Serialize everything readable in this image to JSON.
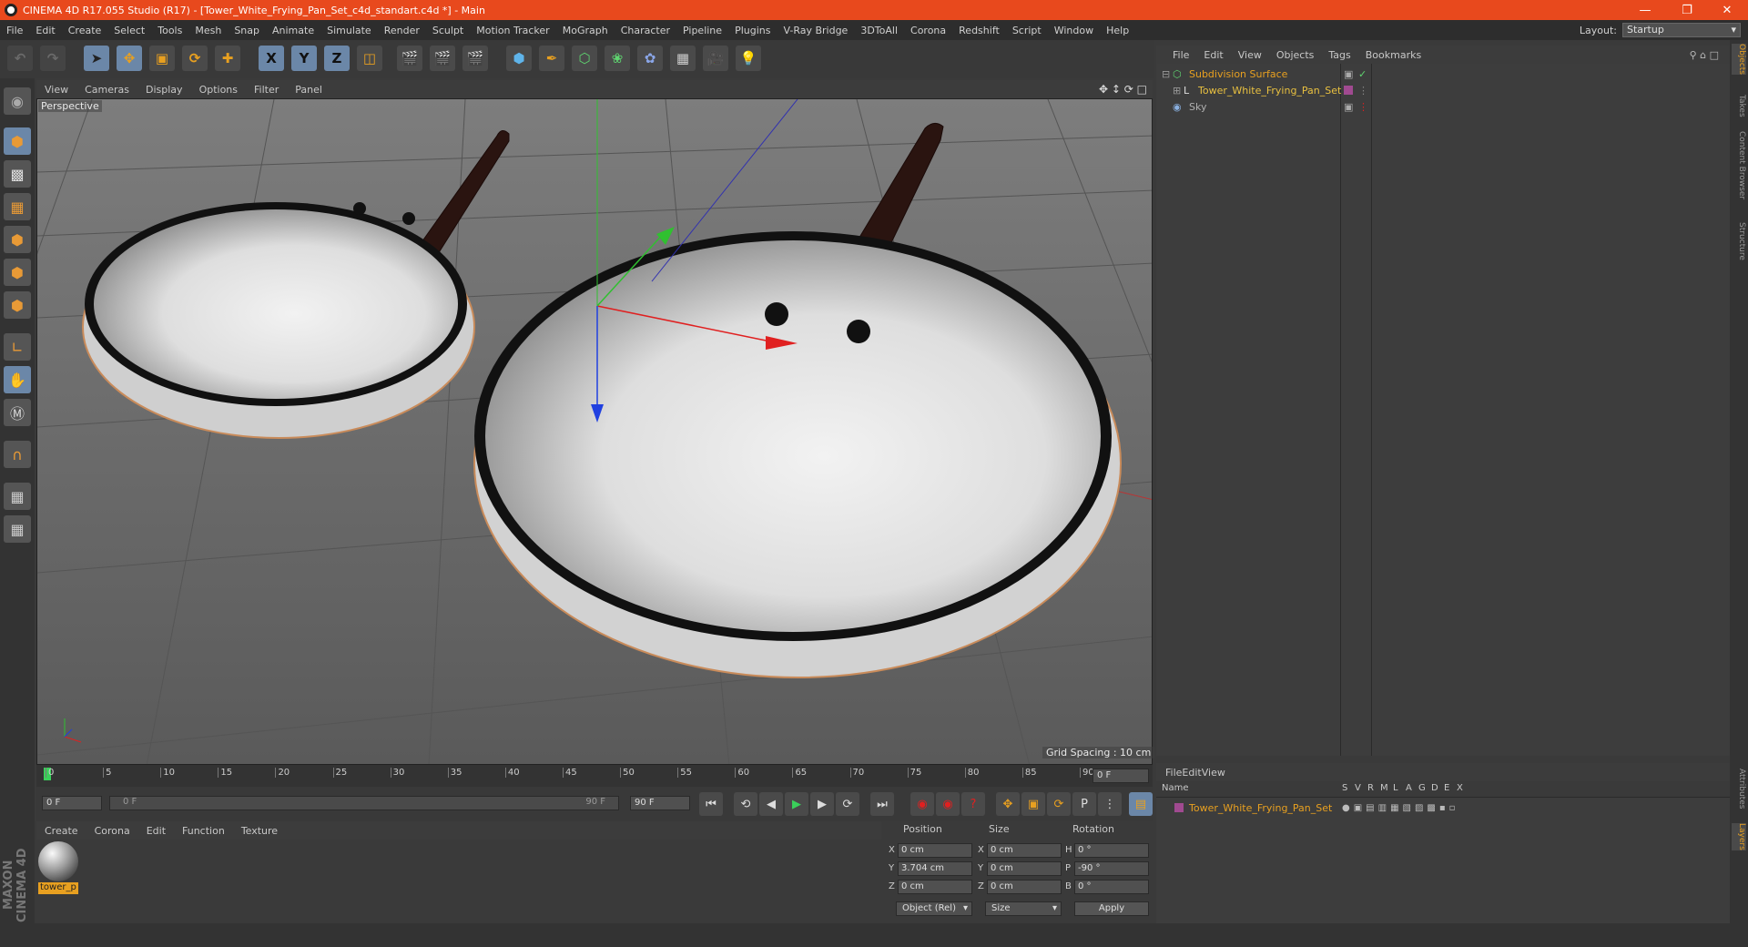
{
  "window": {
    "title": "CINEMA 4D R17.055 Studio (R17) - [Tower_White_Frying_Pan_Set_c4d_standart.c4d *] - Main",
    "minimize_icon": "minimize-icon",
    "restore_icon": "restore-icon",
    "close_icon": "close-icon"
  },
  "menu": [
    "File",
    "Edit",
    "Create",
    "Select",
    "Tools",
    "Mesh",
    "Snap",
    "Animate",
    "Simulate",
    "Render",
    "Sculpt",
    "Motion Tracker",
    "MoGraph",
    "Character",
    "Pipeline",
    "Plugins",
    "V-Ray Bridge",
    "3DToAll",
    "Corona",
    "Redshift",
    "Script",
    "Window",
    "Help"
  ],
  "layout": {
    "label": "Layout:",
    "value": "Startup"
  },
  "toolbar": {
    "axis_x": "X",
    "axis_y": "Y",
    "axis_z": "Z"
  },
  "viewport": {
    "menu": [
      "View",
      "Cameras",
      "Display",
      "Options",
      "Filter",
      "Panel"
    ],
    "camera_label": "Perspective",
    "grid_spacing": "Grid Spacing : 10 cm"
  },
  "timeline": {
    "ticks": [
      "0",
      "5",
      "10",
      "15",
      "20",
      "25",
      "30",
      "35",
      "40",
      "45",
      "50",
      "55",
      "60",
      "65",
      "70",
      "75",
      "80",
      "85",
      "90"
    ],
    "current_frame": "0 F",
    "start_field": "0 F",
    "range_start": "0 F",
    "range_end": "90 F",
    "end_field": "90 F"
  },
  "materials": {
    "menu": [
      "Create",
      "Corona",
      "Edit",
      "Function",
      "Texture"
    ],
    "items": [
      {
        "label": "tower_p"
      }
    ]
  },
  "coords": {
    "headers": {
      "position": "Position",
      "size": "Size",
      "rotation": "Rotation"
    },
    "rows": [
      {
        "axis": "X",
        "pos": "0 cm",
        "saxis": "X",
        "size": "0 cm",
        "raxis": "H",
        "rot": "0 °"
      },
      {
        "axis": "Y",
        "pos": "3.704 cm",
        "saxis": "Y",
        "size": "0 cm",
        "raxis": "P",
        "rot": "-90 °"
      },
      {
        "axis": "Z",
        "pos": "0 cm",
        "saxis": "Z",
        "size": "0 cm",
        "raxis": "B",
        "rot": "0 °"
      }
    ],
    "mode_select": "Object (Rel)",
    "size_select": "Size",
    "apply": "Apply"
  },
  "objects": {
    "menu": [
      "File",
      "Edit",
      "View",
      "Objects",
      "Tags",
      "Bookmarks"
    ],
    "items": [
      {
        "name": "Subdivision Surface",
        "color": "#e8a020"
      },
      {
        "name": "Tower_White_Frying_Pan_Set",
        "color": "#e8c040"
      },
      {
        "name": "Sky",
        "color": "#b0b0b0"
      }
    ]
  },
  "layers": {
    "menu": [
      "File",
      "Edit",
      "View"
    ],
    "columns": [
      "Name",
      "S",
      "V",
      "R",
      "M",
      "L",
      "A",
      "G",
      "D",
      "E",
      "X"
    ],
    "items": [
      {
        "name": "Tower_White_Frying_Pan_Set",
        "color": "#e8a020"
      }
    ]
  },
  "right_tabs": [
    "Objects",
    "Takes",
    "Content Browser",
    "Structure",
    "Attributes",
    "Layers"
  ],
  "brand": "MAXON CINEMA 4D",
  "colors": {
    "titlebar": "#e8491d",
    "accent": "#e8a020",
    "active_tool": "#6b87a8"
  }
}
